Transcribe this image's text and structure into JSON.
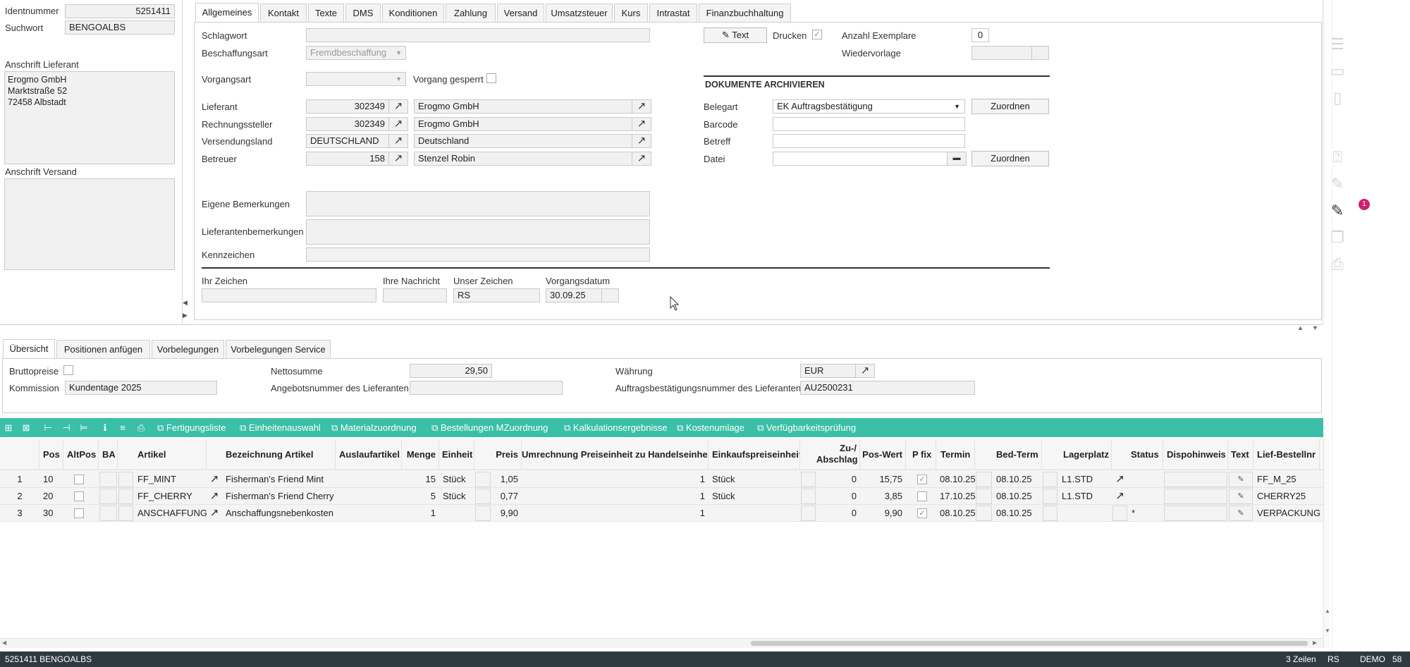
{
  "left_panel": {
    "identnummer_label": "Identnummer",
    "identnummer": "5251411",
    "suchwort_label": "Suchwort",
    "suchwort": "BENGOALBS",
    "anschrift_lieferant_label": "Anschrift Lieferant",
    "anschrift_lieferant": [
      "Erogmo GmbH",
      "Marktstraße 52",
      "72458 Albstadt"
    ],
    "anschrift_versand_label": "Anschrift Versand"
  },
  "tabs": [
    "Allgemeines",
    "Kontakt",
    "Texte",
    "DMS",
    "Konditionen",
    "Zahlung",
    "Versand",
    "Umsatzsteuer",
    "Kurs",
    "Intrastat",
    "Finanzbuchhaltung"
  ],
  "form": {
    "schlagwort_label": "Schlagwort",
    "schlagwort": "",
    "beschaffungsart_label": "Beschaffungsart",
    "beschaffungsart": "Fremdbeschaffung",
    "vorgangsart_label": "Vorgangsart",
    "vorgangsart": "",
    "vorgang_gesperrt_label": "Vorgang gesperrt",
    "lieferant_label": "Lieferant",
    "lieferant_nr": "302349",
    "lieferant_name": "Erogmo GmbH",
    "rechnungssteller_label": "Rechnungssteller",
    "rechnungssteller_nr": "302349",
    "rechnungssteller_name": "Erogmo GmbH",
    "versendungsland_label": "Versendungsland",
    "versendungsland_code": "DEUTSCHLAND",
    "versendungsland_name": "Deutschland",
    "betreuer_label": "Betreuer",
    "betreuer_nr": "158",
    "betreuer_name": "Stenzel Robin",
    "eigene_bemerkungen_label": "Eigene Bemerkungen",
    "lieferantenbemerkungen_label": "Lieferantenbemerkungen",
    "kennzeichen_label": "Kennzeichen",
    "text_button": "Text",
    "drucken_label": "Drucken",
    "anzahl_exemplare_label": "Anzahl Exemplare",
    "anzahl_exemplare": "0",
    "wiedervorlage_label": "Wiedervorlage",
    "ihr_zeichen_label": "Ihr Zeichen",
    "ihre_nachricht_label": "Ihre Nachricht",
    "unser_zeichen_label": "Unser Zeichen",
    "unser_zeichen": "RS",
    "vorgangsdatum_label": "Vorgangsdatum",
    "vorgangsdatum": "30.09.25"
  },
  "archive": {
    "title": "DOKUMENTE ARCHIVIEREN",
    "belegart_label": "Belegart",
    "belegart": "EK Auftragsbestätigung",
    "barcode_label": "Barcode",
    "betreff_label": "Betreff",
    "datei_label": "Datei",
    "zuordnen": "Zuordnen"
  },
  "bottom_tabs": [
    "Übersicht",
    "Positionen anfügen",
    "Vorbelegungen",
    "Vorbelegungen Service"
  ],
  "summary": {
    "bruttopreise_label": "Bruttopreise",
    "kommission_label": "Kommission",
    "kommission": "Kundentage 2025",
    "nettosumme_label": "Nettosumme",
    "nettosumme": "29,50",
    "angebotsnummer_label": "Angebotsnummer des Lieferanten",
    "waehrung_label": "Währung",
    "waehrung": "EUR",
    "ab_nummer_label": "Auftragsbestätigungsnummer des Lieferanten",
    "ab_nummer": "AU2500231"
  },
  "toolbar": [
    "Fertigungsliste",
    "Einheitenauswahl",
    "Materialzuordnung",
    "Bestellungen MZuordnung",
    "Kalkulationsergebnisse",
    "Kostenumlage",
    "Verfügbarkeitsprüfung"
  ],
  "table": {
    "headers": {
      "pos": "Pos",
      "altpos": "AltPos",
      "ba": "BA",
      "artikel": "Artikel",
      "bezeichnung": "Bezeichnung Artikel",
      "auslauf": "Auslaufartikel",
      "menge": "Menge",
      "einheit": "Einheit",
      "preis": "Preis",
      "umrechnung": "Umrechnung Preiseinheit zu Handelseinheit",
      "ekpe": "Einkaufspreiseinheit",
      "zuab1": "Zu-/",
      "zuab2": "Abschlag",
      "poswert": "Pos-Wert",
      "pfix": "P fix",
      "termin": "Termin",
      "bedterm": "Bed-Term",
      "lagerplatz": "Lagerplatz",
      "status": "Status",
      "dispo": "Dispohinweis",
      "text": "Text",
      "liefbest": "Lief-Bestellnr"
    },
    "rows": [
      {
        "nr": "1",
        "pos": "10",
        "artikel": "FF_MINT",
        "bezeichnung": "Fisherman's Friend Mint",
        "menge": "15",
        "einheit": "Stück",
        "preis": "1,05",
        "umrechnung": "1",
        "ekpe": "Stück",
        "zuab": "0",
        "poswert": "15,75",
        "pfix": true,
        "termin": "08.10.25",
        "bedterm": "08.10.25",
        "lagerplatz": "L1.STD",
        "status": "",
        "liefbest": "FF_M_25"
      },
      {
        "nr": "2",
        "pos": "20",
        "artikel": "FF_CHERRY",
        "bezeichnung": "Fisherman's Friend Cherry",
        "menge": "5",
        "einheit": "Stück",
        "preis": "0,77",
        "umrechnung": "1",
        "ekpe": "Stück",
        "zuab": "0",
        "poswert": "3,85",
        "pfix": false,
        "termin": "17.10.25",
        "bedterm": "08.10.25",
        "lagerplatz": "L1.STD",
        "status": "",
        "liefbest": "CHERRY25"
      },
      {
        "nr": "3",
        "pos": "30",
        "artikel": "ANSCHAFFUNG",
        "bezeichnung": "Anschaffungsnebenkosten",
        "menge": "1",
        "einheit": "",
        "preis": "9,90",
        "umrechnung": "1",
        "ekpe": "",
        "zuab": "0",
        "poswert": "9,90",
        "pfix": true,
        "termin": "08.10.25",
        "bedterm": "08.10.25",
        "lagerplatz": "",
        "status": "*",
        "liefbest": "VERPACKUNG"
      }
    ]
  },
  "status_bar": {
    "left": "5251411 BENGOALBS",
    "rows": "3 Zeilen",
    "user": "RS",
    "mode": "DEMO",
    "num": "58"
  },
  "side": {
    "badge": "1"
  },
  "colors": {
    "accent": "#3bbfa6",
    "badge": "#d0206f",
    "statusbar": "#2f3a40"
  }
}
